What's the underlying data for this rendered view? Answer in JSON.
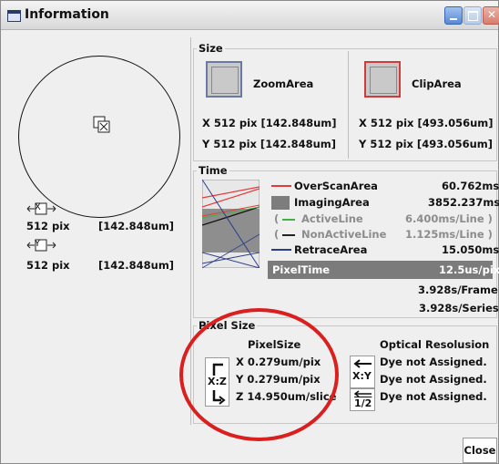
{
  "window": {
    "title": "Information",
    "close_label": "Close"
  },
  "left": {
    "x_size": "512 pix",
    "x_um": "[142.848um]",
    "y_size": "512 pix",
    "y_um": "[142.848um]",
    "x_axis_glyph": "X",
    "y_axis_glyph": "Y"
  },
  "size": {
    "legend": "Size",
    "zoom": {
      "label": "ZoomArea",
      "x": "X  512 pix [142.848um]",
      "y": "Y  512 pix [142.848um]"
    },
    "clip": {
      "label": "ClipArea",
      "x": "X  512 pix [493.056um]",
      "y": "Y  512 pix [493.056um]"
    }
  },
  "time": {
    "legend": "Time",
    "rows": [
      {
        "prefix": "",
        "label": "OverScanArea",
        "value": "60.762ms",
        "active": true
      },
      {
        "prefix": "",
        "label": "ImagingArea",
        "value": "3852.237ms",
        "active": true
      },
      {
        "prefix": "(",
        "label": "ActiveLine",
        "value": "6.400ms/Line )",
        "active": false
      },
      {
        "prefix": "(",
        "label": "NonActiveLine",
        "value": "1.125ms/Line )",
        "active": false
      },
      {
        "prefix": "",
        "label": "RetraceArea",
        "value": "15.050ms",
        "active": true
      }
    ],
    "pixel_time": {
      "label": "PixelTime",
      "value": "12.5us/pix"
    },
    "frame": "3.928s/Frame",
    "series": "3.928s/Series",
    "colors": {
      "overscan": "#e23b3b",
      "imaging": "#7d7d7d",
      "active": "#43b043",
      "nonactive": "#222222",
      "retrace": "#2b3c8a"
    }
  },
  "pixel_size": {
    "legend": "Pixel Size",
    "heading": "PixelSize",
    "x": "X  0.279um/pix",
    "y": "Y  0.279um/pix",
    "z": "Z  14.950um/slice",
    "xz_button": "X:Z",
    "optical": {
      "heading": "Optical Resolusion",
      "xy_button": "X:Y",
      "half_button": "1/2",
      "rows": [
        "Dye not Assigned.",
        "Dye not Assigned.",
        "Dye not Assigned."
      ]
    }
  }
}
